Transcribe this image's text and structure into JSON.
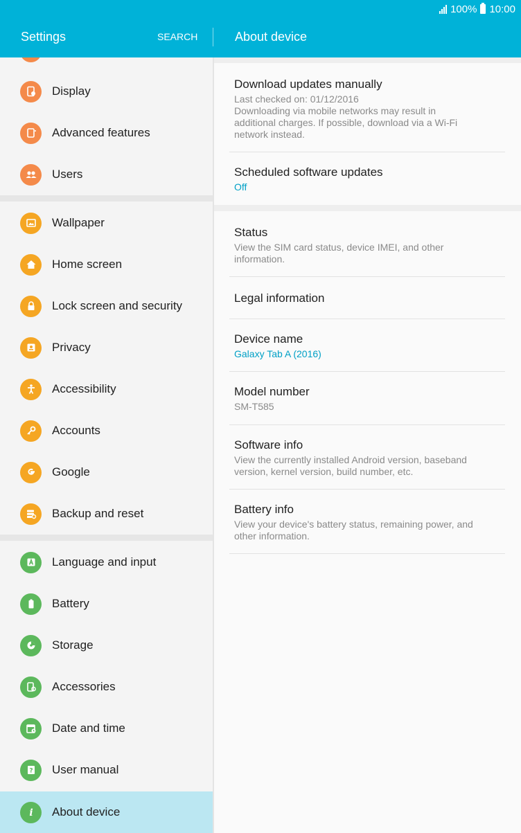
{
  "status_bar": {
    "battery_text": "100%",
    "time": "10:00"
  },
  "app_bar": {
    "title": "Settings",
    "search_label": "SEARCH",
    "detail_title": "About device"
  },
  "sidebar": {
    "items": [
      {
        "label": "Display",
        "icon": "display-icon",
        "color": "#f48a4a"
      },
      {
        "label": "Advanced features",
        "icon": "advanced-features-icon",
        "color": "#f48a4a"
      },
      {
        "label": "Users",
        "icon": "users-icon",
        "color": "#f48a4a"
      },
      {
        "label": "Wallpaper",
        "icon": "wallpaper-icon",
        "color": "#f5a623"
      },
      {
        "label": "Home screen",
        "icon": "home-icon",
        "color": "#f5a623"
      },
      {
        "label": "Lock screen and security",
        "icon": "lock-icon",
        "color": "#f5a623"
      },
      {
        "label": "Privacy",
        "icon": "privacy-icon",
        "color": "#f5a623"
      },
      {
        "label": "Accessibility",
        "icon": "accessibility-icon",
        "color": "#f5a623"
      },
      {
        "label": "Accounts",
        "icon": "key-icon",
        "color": "#f5a623"
      },
      {
        "label": "Google",
        "icon": "google-icon",
        "color": "#f5a623"
      },
      {
        "label": "Backup and reset",
        "icon": "backup-icon",
        "color": "#f5a623"
      },
      {
        "label": "Language and input",
        "icon": "language-icon",
        "color": "#5cb85c"
      },
      {
        "label": "Battery",
        "icon": "battery-icon",
        "color": "#5cb85c"
      },
      {
        "label": "Storage",
        "icon": "storage-icon",
        "color": "#5cb85c"
      },
      {
        "label": "Accessories",
        "icon": "accessories-icon",
        "color": "#5cb85c"
      },
      {
        "label": "Date and time",
        "icon": "calendar-icon",
        "color": "#5cb85c"
      },
      {
        "label": "User manual",
        "icon": "manual-icon",
        "color": "#5cb85c"
      },
      {
        "label": "About device",
        "icon": "info-icon",
        "color": "#5cb85c",
        "selected": true
      }
    ]
  },
  "detail": {
    "download": {
      "title": "Download updates manually",
      "last_checked": "Last checked on: 01/12/2016",
      "note_lines": [
        "Downloading via mobile networks may result in",
        "additional charges. If possible, download via a Wi-Fi",
        "network instead."
      ]
    },
    "scheduled": {
      "title": "Scheduled software updates",
      "value": "Off"
    },
    "status": {
      "title": "Status",
      "lines": [
        "View the SIM card status, device IMEI, and other",
        "information."
      ]
    },
    "legal": {
      "title": "Legal information"
    },
    "device_name": {
      "title": "Device name",
      "value": "Galaxy Tab A (2016)"
    },
    "model_number": {
      "title": "Model number",
      "value": "SM-T585"
    },
    "software_info": {
      "title": "Software info",
      "lines": [
        "View the currently installed Android version, baseband",
        "version, kernel version, build number, etc."
      ]
    },
    "battery_info": {
      "title": "Battery info",
      "lines": [
        "View your device's battery status, remaining power, and",
        "other information."
      ]
    }
  },
  "accent_colors": {
    "app_bar": "#00b2d8",
    "link": "#00a0c6",
    "selected_row": "#bbe7f2"
  }
}
